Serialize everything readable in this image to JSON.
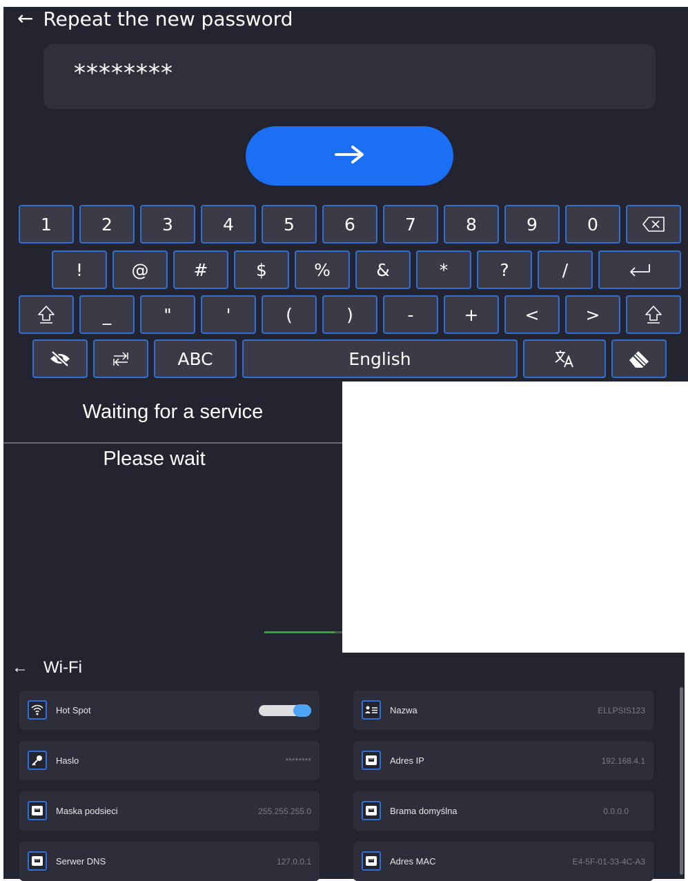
{
  "keyboard_screen": {
    "title": "Repeat the new password",
    "password_value": "********",
    "colors": {
      "background": "#23242f",
      "key": "#3a3b46",
      "key_border": "#2f6fd6",
      "accent": "#1a6ff5"
    },
    "rows": [
      [
        "1",
        "2",
        "3",
        "4",
        "5",
        "6",
        "7",
        "8",
        "9",
        "0"
      ],
      [
        "!",
        "@",
        "#",
        "$",
        "%",
        "&",
        "*",
        "?",
        "/"
      ],
      [
        "_",
        "\"",
        "'",
        "(",
        ")",
        "-",
        "+",
        "<",
        ">"
      ]
    ],
    "bottom": {
      "abc_label": "ABC",
      "space_label": "English"
    },
    "icons": [
      "back-arrow-icon",
      "enter-arrow-icon",
      "backspace-icon",
      "return-icon",
      "shift-icon",
      "hide-password-icon",
      "swap-cursor-icon",
      "translate-icon",
      "eraser-icon"
    ]
  },
  "waiting_screen": {
    "title": "Waiting for a service",
    "message": "Please wait",
    "progress": 0.9
  },
  "wifi_screen": {
    "title": "Wi-Fi",
    "items": [
      {
        "label": "Hot Spot",
        "value": "",
        "icon": "wifi-icon",
        "toggle_on": true
      },
      {
        "label": "Nazwa",
        "value": "ELLPSIS123",
        "icon": "id-card-icon"
      },
      {
        "label": "Haslo",
        "value": "********",
        "icon": "key-icon"
      },
      {
        "label": "Adres IP",
        "value": "192.168.4.1",
        "icon": "network-port-icon"
      },
      {
        "label": "Maska podsieci",
        "value": "255.255.255.0",
        "icon": "network-port-icon"
      },
      {
        "label": "Brama domyślna",
        "value": "0.0.0.0",
        "icon": "network-port-icon"
      },
      {
        "label": "Serwer DNS",
        "value": "127.0.0.1",
        "icon": "network-port-icon"
      },
      {
        "label": "Adres MAC",
        "value": "E4-5F-01-33-4C-A3",
        "icon": "network-port-icon"
      }
    ]
  }
}
